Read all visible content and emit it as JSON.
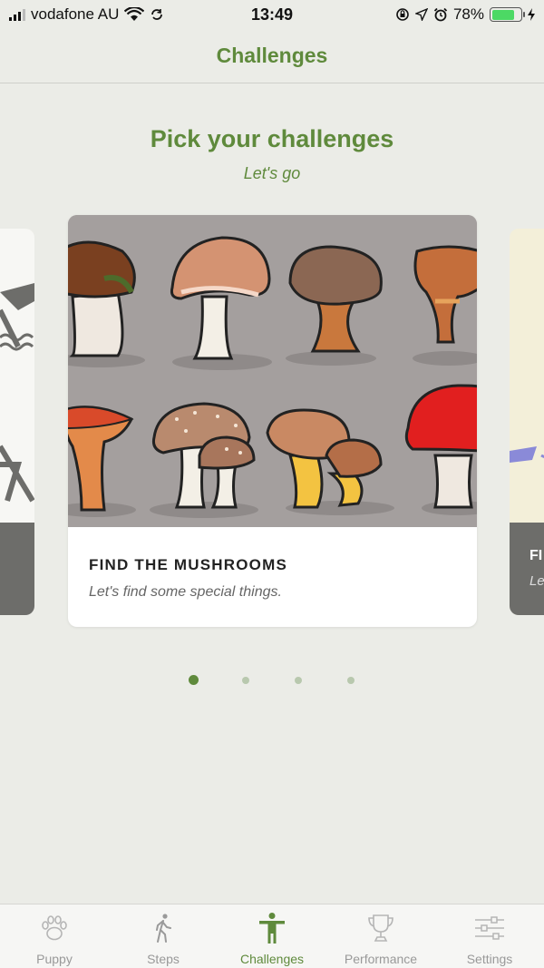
{
  "status_bar": {
    "carrier": "vodafone AU",
    "time": "13:49",
    "battery_percent": "78%",
    "battery_level": 0.78
  },
  "nav": {
    "title": "Challenges"
  },
  "header": {
    "title": "Pick your challenges",
    "subtitle": "Let's go"
  },
  "cards": {
    "current": {
      "title": "FIND THE MUSHROOMS",
      "subtitle": "Let's find some special things.",
      "image_icon": "mushrooms-illustration"
    },
    "next_peek": {
      "title": "FI",
      "subtitle": "Le"
    }
  },
  "pagination": {
    "total": 4,
    "active_index": 0
  },
  "tabs": [
    {
      "label": "Puppy",
      "icon": "paw-icon"
    },
    {
      "label": "Steps",
      "icon": "walking-icon"
    },
    {
      "label": "Challenges",
      "icon": "person-icon",
      "active": true
    },
    {
      "label": "Performance",
      "icon": "trophy-icon"
    },
    {
      "label": "Settings",
      "icon": "sliders-icon"
    }
  ],
  "colors": {
    "accent": "#5f8a3c",
    "background": "#ebece7",
    "inactive": "#999999"
  }
}
